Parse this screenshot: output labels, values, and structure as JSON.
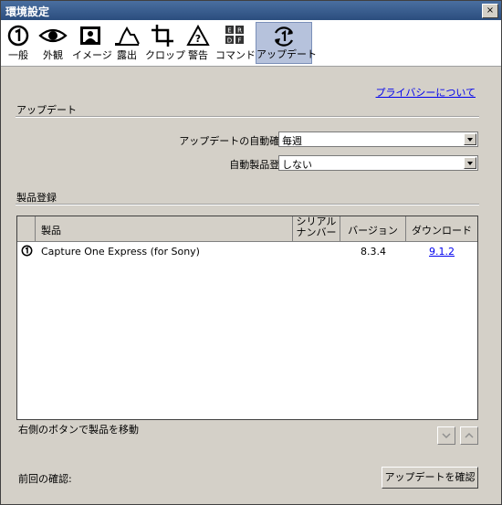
{
  "window": {
    "title": "環境設定",
    "close": "×"
  },
  "toolbar": {
    "tabs": [
      {
        "label": "一般",
        "icon": "general-icon"
      },
      {
        "label": "外観",
        "icon": "eye-icon"
      },
      {
        "label": "イメージ",
        "icon": "image-icon"
      },
      {
        "label": "露出",
        "icon": "exposure-icon"
      },
      {
        "label": "クロップ",
        "icon": "crop-icon"
      },
      {
        "label": "警告",
        "icon": "warning-icon"
      },
      {
        "label": "コマンド",
        "icon": "command-icon"
      },
      {
        "label": "アップデート",
        "icon": "update-icon",
        "active": true
      }
    ],
    "command_icon_letters": [
      "E",
      "R",
      "D",
      "F"
    ]
  },
  "privacy_link": "プライバシーについて",
  "update_section": {
    "title": "アップデート",
    "auto_check_label": "アップデートの自動確認:",
    "auto_check_value": "毎週",
    "auto_register_label": "自動製品登録:",
    "auto_register_value": "しない"
  },
  "registration_section": {
    "title": "製品登録",
    "columns": [
      "製品",
      "シリアル\nナンバー",
      "バージョン",
      "ダウンロード"
    ],
    "rows": [
      {
        "product": "Capture One Express (for Sony)",
        "serial": "",
        "version": "8.3.4",
        "download": "9.1.2"
      }
    ],
    "hint": "右側のボタンで製品を移動"
  },
  "footer": {
    "last_check_label": "前回の確認:",
    "check_button": "アップデートを確認"
  },
  "colors": {
    "titlebar": "#2b4d7e",
    "active_tab": "#b6c2dc",
    "link": "#0000ee"
  }
}
